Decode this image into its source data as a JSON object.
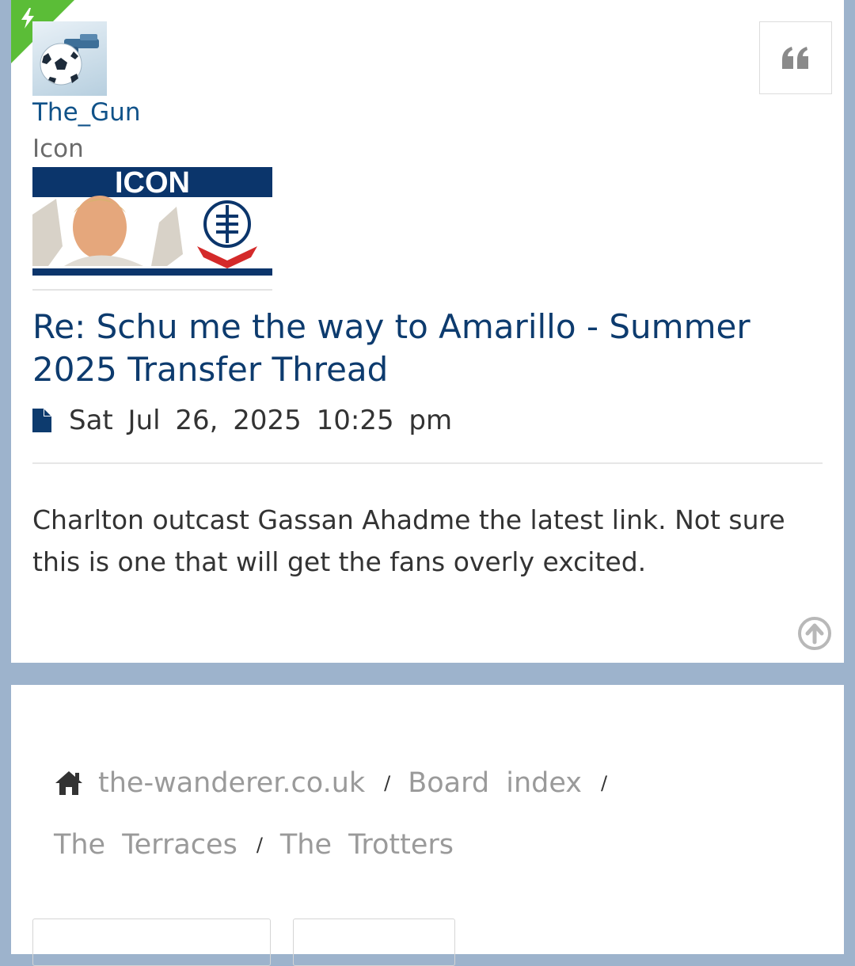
{
  "post": {
    "author": "The_Gun",
    "rank": "Icon",
    "rank_banner_text": "ICON",
    "title": "Re: Schu me the way to Amarillo - Summer 2025 Transfer Thread",
    "date": "Sat Jul 26, 2025 10:25 pm",
    "body": "Charlton outcast Gassan Ahadme the latest link. Not sure this is one that will get the fans overly excited."
  },
  "breadcrumbs": {
    "home": "the-wanderer.co.uk",
    "board_index": "Board index",
    "forum_parent": "The Terraces",
    "forum": "The Trotters",
    "separator": "/"
  },
  "icons": {
    "quote": "quote-icon",
    "post": "file-icon",
    "top": "arrow-up-circle-icon",
    "home": "home-icon",
    "unread": "bolt-icon"
  },
  "colors": {
    "page_background": "#9db3cc",
    "link": "#105289",
    "title": "#0d3b6e",
    "unread_marker": "#5bbd37",
    "banner_navy": "#0b356b"
  }
}
